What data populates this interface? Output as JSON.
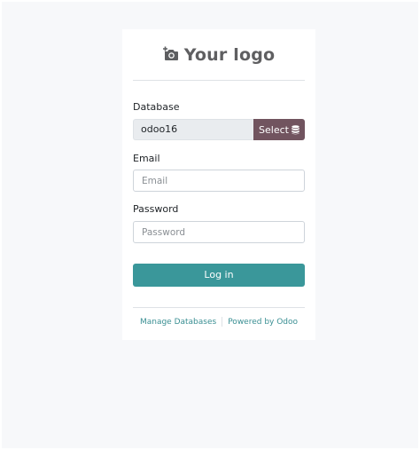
{
  "logo": {
    "text": "Your logo",
    "icon": "camera-icon"
  },
  "database": {
    "label": "Database",
    "value": "odoo16",
    "select_label": "Select",
    "select_icon": "database-icon",
    "select_color": "#71545f"
  },
  "email": {
    "label": "Email",
    "placeholder": "Email"
  },
  "password": {
    "label": "Password",
    "placeholder": "Password"
  },
  "login": {
    "label": "Log in",
    "color": "#3a979a"
  },
  "footer": {
    "manage_databases": "Manage Databases",
    "powered_by": "Powered by Odoo",
    "link_color": "#3a8f93"
  }
}
